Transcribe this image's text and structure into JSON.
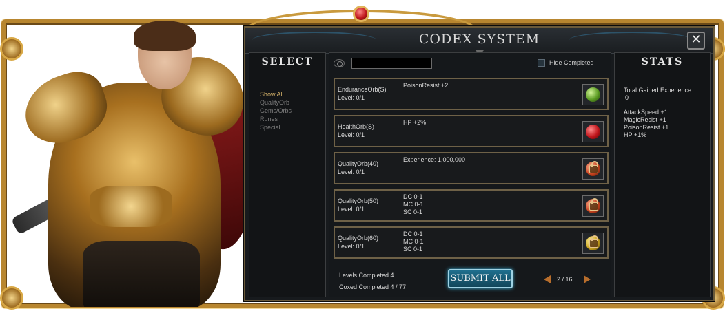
{
  "window": {
    "title": "CODEX SYSTEM",
    "close_label": "✕"
  },
  "select": {
    "heading": "SELECT",
    "categories": [
      {
        "label": "Show All",
        "active": true
      },
      {
        "label": "QualityOrb",
        "active": false
      },
      {
        "label": "Gems/Orbs",
        "active": false
      },
      {
        "label": "Runes",
        "active": false
      },
      {
        "label": "Special",
        "active": false
      }
    ]
  },
  "toolbar": {
    "search_value": "",
    "hide_completed_label": "Hide Completed",
    "hide_completed_checked": false
  },
  "rows": [
    {
      "name": "EnduranceOrb(S)",
      "level": "Level: 0/1",
      "effects": [
        "PoisonResist +2"
      ],
      "icon": "green-orb-icon"
    },
    {
      "name": "HealthOrb(S)",
      "level": "Level: 0/1",
      "effects": [
        "HP +2%"
      ],
      "icon": "red-orb-icon"
    },
    {
      "name": "QualityOrb(40)",
      "level": "Level: 0/1",
      "effects": [
        "Experience: 1,000,000"
      ],
      "icon": "locked-red-orb-icon"
    },
    {
      "name": "QualityOrb(50)",
      "level": "Level: 0/1",
      "effects": [
        "DC 0-1",
        "MC 0-1",
        "SC 0-1"
      ],
      "icon": "locked-red-orb-icon"
    },
    {
      "name": "QualityOrb(60)",
      "level": "Level: 0/1",
      "effects": [
        "DC 0-1",
        "MC 0-1",
        "SC 0-1"
      ],
      "icon": "locked-yellow-orb-icon"
    }
  ],
  "footer": {
    "levels_completed": "Levels Completed 4",
    "coxed_completed": "Coxed Completed 4 / 77",
    "submit_label": "SUBMIT ALL",
    "page": "2 / 16"
  },
  "stats": {
    "heading": "STATS",
    "total_label": "Total Gained Experience:",
    "total_value": "0",
    "bonuses": [
      "AttackSpeed +1",
      "MagicResist +1",
      "PoisonResist +1",
      "HP +1%"
    ]
  },
  "colors": {
    "gold_frame": "#b8862f",
    "active_category": "#d6b36a",
    "submit_glow": "#3db0d6",
    "pager_arrow": "#b76d2c"
  }
}
